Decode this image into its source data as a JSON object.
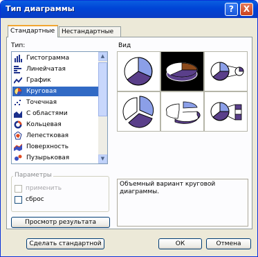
{
  "window": {
    "title": "Тип диаграммы",
    "help_glyph": "?",
    "close_glyph": "X"
  },
  "tabs": [
    {
      "label": "Стандартные",
      "active": true
    },
    {
      "label": "Нестандартные",
      "active": false
    }
  ],
  "type_list": {
    "label": "Тип:",
    "items": [
      {
        "label": "Гистограмма",
        "icon": "histogram-icon"
      },
      {
        "label": "Линейчатая",
        "icon": "bar-chart-icon"
      },
      {
        "label": "График",
        "icon": "line-chart-icon"
      },
      {
        "label": "Круговая",
        "icon": "pie-chart-icon",
        "selected": true
      },
      {
        "label": "Точечная",
        "icon": "scatter-chart-icon"
      },
      {
        "label": "С областями",
        "icon": "area-chart-icon"
      },
      {
        "label": "Кольцевая",
        "icon": "doughnut-chart-icon"
      },
      {
        "label": "Лепестковая",
        "icon": "radar-chart-icon"
      },
      {
        "label": "Поверхность",
        "icon": "surface-chart-icon"
      },
      {
        "label": "Пузырьковая",
        "icon": "bubble-chart-icon"
      }
    ]
  },
  "view": {
    "label": "Вид",
    "selected_index": 1,
    "subtypes": [
      "pie",
      "3d-pie",
      "pie-of-pie",
      "exploded-pie",
      "exploded-3d-pie",
      "bar-of-pie"
    ]
  },
  "params": {
    "title": "Параметры",
    "apply_label": "применить",
    "reset_label": "сброс"
  },
  "preview_button": "Просмотр результата",
  "description": "Объемный вариант круговой диаграммы.",
  "footer": {
    "default_button": "Сделать стандартной",
    "ok_button": "ОК",
    "cancel_button": "Отмена"
  },
  "colors": {
    "title_bar": "#0a5ee0",
    "selection": "#316ac5",
    "pie_blue": "#8b9fe8",
    "pie_purple": "#5a3f8a",
    "pie_white": "#ffffff",
    "pie_brown": "#8b4a1c"
  }
}
